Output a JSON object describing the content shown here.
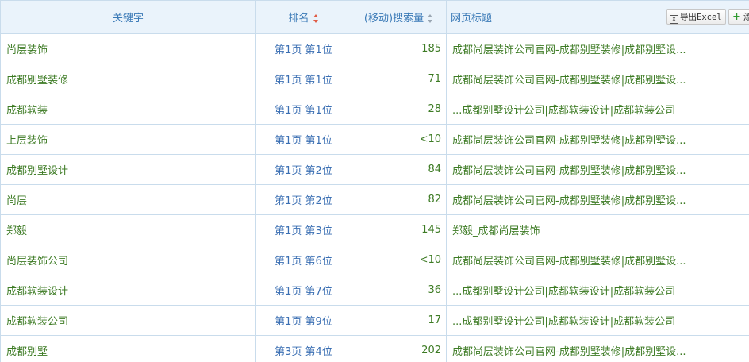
{
  "columns": {
    "keyword": "关键字",
    "rank": "排名",
    "volume": "(移动)搜索量",
    "title": "网页标题"
  },
  "toolbar": {
    "export_label": "导出Excel",
    "add_label": "添"
  },
  "rows": [
    {
      "keyword": "尚层装饰",
      "rank": "第1页 第1位",
      "volume": "185",
      "title": "成都尚层装饰公司官网-成都别墅装修|成都别墅设..."
    },
    {
      "keyword": "成都别墅装修",
      "rank": "第1页 第1位",
      "volume": "71",
      "title": "成都尚层装饰公司官网-成都别墅装修|成都别墅设..."
    },
    {
      "keyword": "成都软装",
      "rank": "第1页 第1位",
      "volume": "28",
      "title": "...成都别墅设计公司|成都软装设计|成都软装公司"
    },
    {
      "keyword": "上层装饰",
      "rank": "第1页 第1位",
      "volume": "<10",
      "title": "成都尚层装饰公司官网-成都别墅装修|成都别墅设..."
    },
    {
      "keyword": "成都别墅设计",
      "rank": "第1页 第2位",
      "volume": "84",
      "title": "成都尚层装饰公司官网-成都别墅装修|成都别墅设..."
    },
    {
      "keyword": "尚层",
      "rank": "第1页 第2位",
      "volume": "82",
      "title": "成都尚层装饰公司官网-成都别墅装修|成都别墅设..."
    },
    {
      "keyword": "郑毅",
      "rank": "第1页 第3位",
      "volume": "145",
      "title": "郑毅_成都尚层装饰"
    },
    {
      "keyword": "尚层装饰公司",
      "rank": "第1页 第6位",
      "volume": "<10",
      "title": "成都尚层装饰公司官网-成都别墅装修|成都别墅设..."
    },
    {
      "keyword": "成都软装设计",
      "rank": "第1页 第7位",
      "volume": "36",
      "title": "...成都别墅设计公司|成都软装设计|成都软装公司"
    },
    {
      "keyword": "成都软装公司",
      "rank": "第1页 第9位",
      "volume": "17",
      "title": "...成都别墅设计公司|成都软装设计|成都软装公司"
    },
    {
      "keyword": "成都别墅",
      "rank": "第3页 第4位",
      "volume": "202",
      "title": "成都尚层装饰公司官网-成都别墅装修|成都别墅设..."
    }
  ]
}
